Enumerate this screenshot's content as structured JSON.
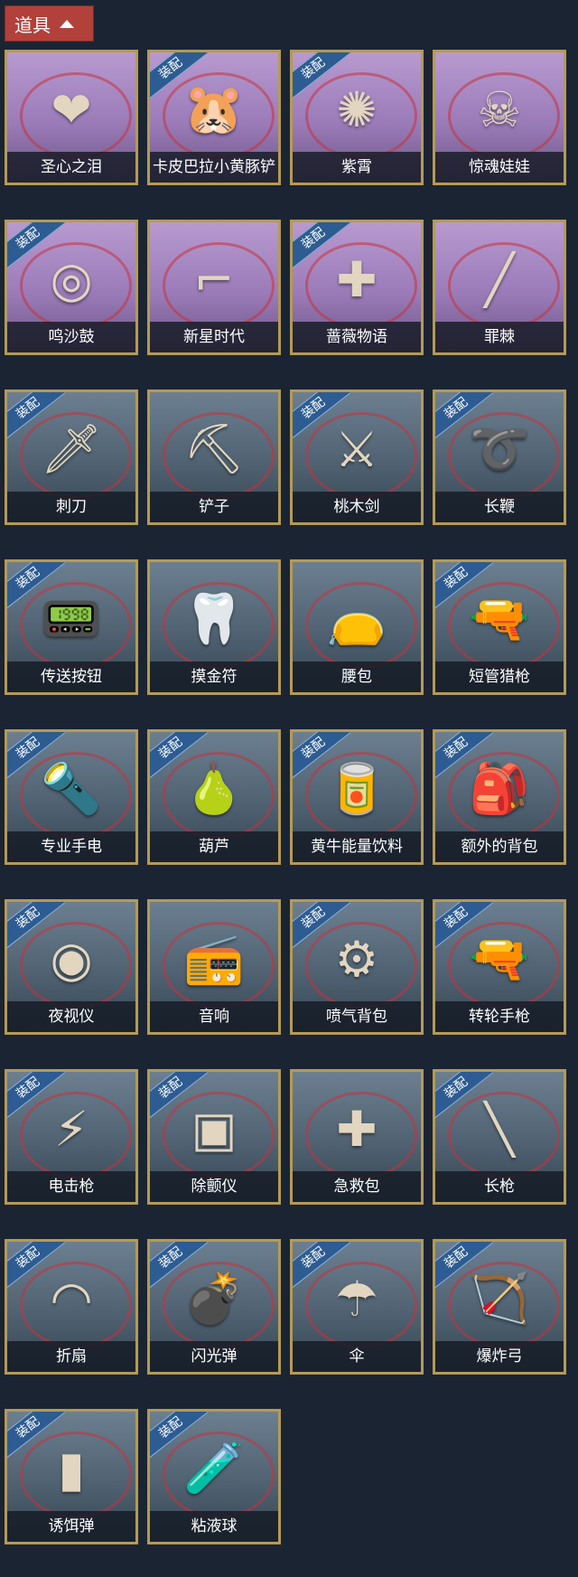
{
  "header": {
    "title": "道具"
  },
  "equipped_badge": "装配",
  "items": [
    {
      "label": "圣心之泪",
      "theme": "purple",
      "equipped": false,
      "icon": "scepter-icon",
      "glyph": "❤"
    },
    {
      "label": "卡皮巴拉小黄豚铲",
      "theme": "purple",
      "equipped": true,
      "icon": "capybara-shovel-icon",
      "glyph": "🐹"
    },
    {
      "label": "紫霄",
      "theme": "purple",
      "equipped": true,
      "icon": "amulet-icon",
      "glyph": "✺"
    },
    {
      "label": "惊魂娃娃",
      "theme": "purple",
      "equipped": false,
      "icon": "doll-icon",
      "glyph": "☠"
    },
    {
      "label": "鸣沙鼓",
      "theme": "purple",
      "equipped": true,
      "icon": "drum-icon",
      "glyph": "◎"
    },
    {
      "label": "新星时代",
      "theme": "purple",
      "equipped": false,
      "icon": "revolver-icon",
      "glyph": "⌐"
    },
    {
      "label": "蔷薇物语",
      "theme": "purple",
      "equipped": true,
      "icon": "medkit-icon",
      "glyph": "✚"
    },
    {
      "label": "罪棘",
      "theme": "purple",
      "equipped": false,
      "icon": "spear-icon",
      "glyph": "╱"
    },
    {
      "label": "刺刀",
      "theme": "gray",
      "equipped": true,
      "icon": "bayonet-icon",
      "glyph": "🗡"
    },
    {
      "label": "铲子",
      "theme": "gray",
      "equipped": false,
      "icon": "shovel-icon",
      "glyph": "⛏"
    },
    {
      "label": "桃木剑",
      "theme": "gray",
      "equipped": true,
      "icon": "wooden-sword-icon",
      "glyph": "⚔"
    },
    {
      "label": "长鞭",
      "theme": "gray",
      "equipped": true,
      "icon": "whip-icon",
      "glyph": "➰"
    },
    {
      "label": "传送按钮",
      "theme": "gray",
      "equipped": true,
      "icon": "remote-button-icon",
      "glyph": "📟"
    },
    {
      "label": "摸金符",
      "theme": "gray",
      "equipped": false,
      "icon": "talisman-icon",
      "glyph": "🦷"
    },
    {
      "label": "腰包",
      "theme": "gray",
      "equipped": false,
      "icon": "waist-bag-icon",
      "glyph": "👝"
    },
    {
      "label": "短管猎枪",
      "theme": "gray",
      "equipped": true,
      "icon": "shotgun-icon",
      "glyph": "🔫"
    },
    {
      "label": "专业手电",
      "theme": "gray",
      "equipped": true,
      "icon": "flashlight-icon",
      "glyph": "🔦"
    },
    {
      "label": "葫芦",
      "theme": "gray",
      "equipped": true,
      "icon": "gourd-icon",
      "glyph": "🍐"
    },
    {
      "label": "黄牛能量饮料",
      "theme": "gray",
      "equipped": true,
      "icon": "energy-drink-icon",
      "glyph": "🥫"
    },
    {
      "label": "额外的背包",
      "theme": "gray",
      "equipped": true,
      "icon": "backpack-icon",
      "glyph": "🎒"
    },
    {
      "label": "夜视仪",
      "theme": "gray",
      "equipped": true,
      "icon": "night-vision-icon",
      "glyph": "◉"
    },
    {
      "label": "音响",
      "theme": "gray",
      "equipped": false,
      "icon": "radio-icon",
      "glyph": "📻"
    },
    {
      "label": "喷气背包",
      "theme": "gray",
      "equipped": true,
      "icon": "jetpack-icon",
      "glyph": "⚙"
    },
    {
      "label": "转轮手枪",
      "theme": "gray",
      "equipped": true,
      "icon": "revolver-icon",
      "glyph": "🔫"
    },
    {
      "label": "电击枪",
      "theme": "gray",
      "equipped": true,
      "icon": "taser-icon",
      "glyph": "⚡"
    },
    {
      "label": "除颤仪",
      "theme": "gray",
      "equipped": true,
      "icon": "defibrillator-icon",
      "glyph": "▣"
    },
    {
      "label": "急救包",
      "theme": "gray",
      "equipped": false,
      "icon": "first-aid-icon",
      "glyph": "✚"
    },
    {
      "label": "长枪",
      "theme": "gray",
      "equipped": true,
      "icon": "long-spear-icon",
      "glyph": "╲"
    },
    {
      "label": "折扇",
      "theme": "gray",
      "equipped": true,
      "icon": "folding-fan-icon",
      "glyph": "◠"
    },
    {
      "label": "闪光弹",
      "theme": "gray",
      "equipped": true,
      "icon": "flashbang-icon",
      "glyph": "💣"
    },
    {
      "label": "伞",
      "theme": "gray",
      "equipped": true,
      "icon": "umbrella-icon",
      "glyph": "☂"
    },
    {
      "label": "爆炸弓",
      "theme": "gray",
      "equipped": true,
      "icon": "bow-icon",
      "glyph": "🏹"
    },
    {
      "label": "诱饵弹",
      "theme": "gray",
      "equipped": true,
      "icon": "decoy-grenade-icon",
      "glyph": "▮"
    },
    {
      "label": "粘液球",
      "theme": "gray",
      "equipped": true,
      "icon": "slime-jar-icon",
      "glyph": "🧪"
    }
  ]
}
